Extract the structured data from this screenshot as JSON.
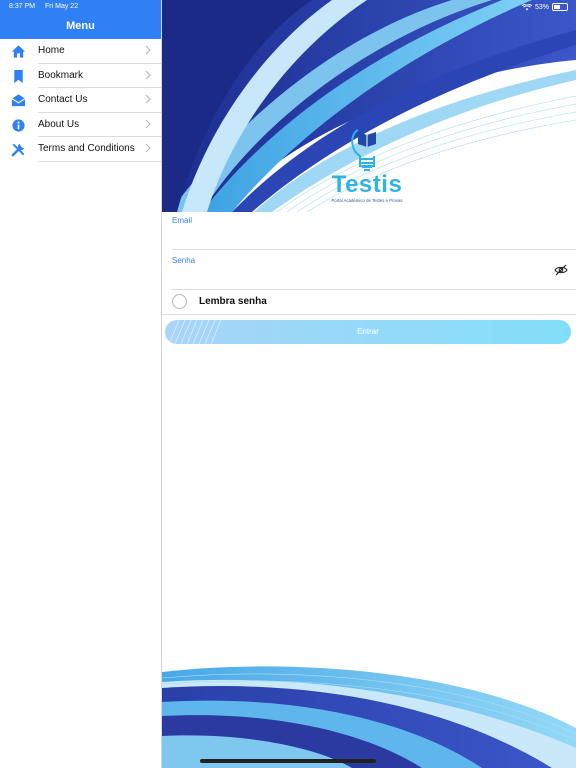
{
  "status_bar": {
    "time": "8:37 PM",
    "date": "Fri May 22",
    "battery": "53%",
    "battery_level": 0.53
  },
  "sidebar": {
    "title": "Menu",
    "items": [
      {
        "label": "Home",
        "icon": "home-icon"
      },
      {
        "label": "Bookmark",
        "icon": "bookmark-icon"
      },
      {
        "label": "Contact Us",
        "icon": "envelope-icon"
      },
      {
        "label": "About Us",
        "icon": "info-icon"
      },
      {
        "label": "Terms and Conditions",
        "icon": "tools-icon"
      }
    ]
  },
  "logo": {
    "name": "Testis",
    "tagline": "Portal Académico de Testes e Provas"
  },
  "form": {
    "email_label": "Email",
    "email_value": "",
    "password_label": "Senha",
    "password_value": "",
    "remember_label": "Lembra senha",
    "remember_checked": false,
    "submit_label": "Entrar"
  },
  "colors": {
    "accent": "#2f80f5",
    "brand": "#2fb3e6",
    "button": "#82def8"
  }
}
